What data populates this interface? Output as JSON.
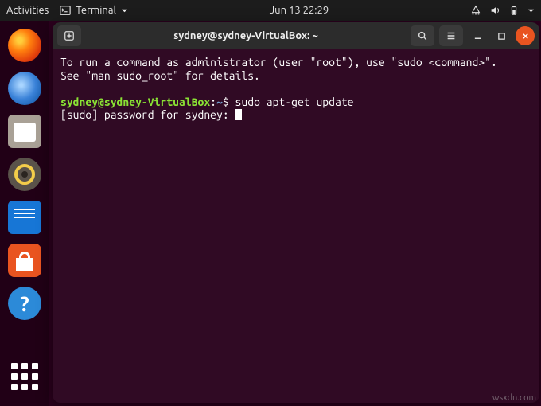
{
  "top_panel": {
    "activities": "Activities",
    "app_name": "Terminal",
    "clock": "Jun 13  22:29"
  },
  "dock": {
    "items": [
      {
        "name": "firefox"
      },
      {
        "name": "thunderbird"
      },
      {
        "name": "files"
      },
      {
        "name": "rhythmbox"
      },
      {
        "name": "libreoffice-writer"
      },
      {
        "name": "ubuntu-software"
      },
      {
        "name": "help"
      }
    ]
  },
  "window": {
    "title": "sydney@sydney-VirtualBox: ~"
  },
  "terminal": {
    "motd_line1": "To run a command as administrator (user \"root\"), use \"sudo <command>\".",
    "motd_line2": "See \"man sudo_root\" for details.",
    "prompt_userhost": "sydney@sydney-VirtualBox",
    "prompt_sep": ":",
    "prompt_path": "~",
    "prompt_symbol": "$",
    "command": "sudo apt-get update",
    "sudo_prompt": "[sudo] password for sydney:"
  },
  "watermark": "wsxdn.com"
}
